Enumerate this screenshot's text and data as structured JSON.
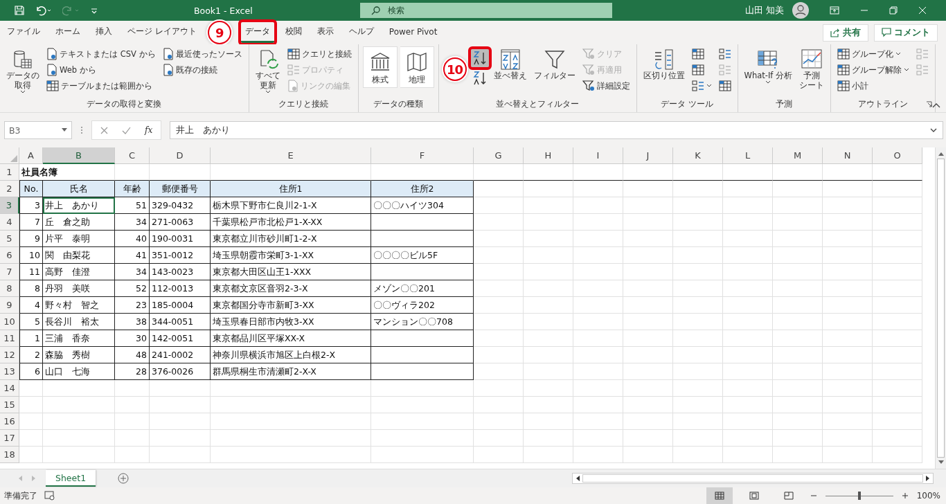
{
  "title_bar": {
    "document_title": "Book1  -  Excel",
    "search": {
      "placeholder": "検索"
    },
    "user": "山田 知美"
  },
  "ribbon_tabs": [
    {
      "label": "ファイル",
      "selected": false,
      "highlighted": false
    },
    {
      "label": "ホーム",
      "selected": false,
      "highlighted": false
    },
    {
      "label": "挿入",
      "selected": false,
      "highlighted": false
    },
    {
      "label": "ページ レイアウト",
      "selected": false,
      "highlighted": false
    },
    {
      "label": "データ",
      "selected": true,
      "highlighted": true
    },
    {
      "label": "校閲",
      "selected": false,
      "highlighted": false
    },
    {
      "label": "表示",
      "selected": false,
      "highlighted": false
    },
    {
      "label": "ヘルプ",
      "selected": false,
      "highlighted": false
    },
    {
      "label": "Power Pivot",
      "selected": false,
      "highlighted": false
    }
  ],
  "share_button": "共有",
  "comment_button": "コメント",
  "ribbon_groups": [
    {
      "title": "データの取得と変換",
      "columns": [
        [
          {
            "kind": "large",
            "lines": [
              "データの",
              "取得"
            ],
            "dropdown": true,
            "disabled": false,
            "highlighted": false
          }
        ],
        [
          {
            "kind": "small",
            "label": "テキストまたは CSV から",
            "dropdown": false,
            "disabled": false,
            "highlighted": false
          },
          {
            "kind": "small",
            "label": "Web から",
            "dropdown": false,
            "disabled": false,
            "highlighted": false
          },
          {
            "kind": "small",
            "label": "テーブルまたは範囲から",
            "dropdown": false,
            "disabled": false,
            "highlighted": false
          }
        ],
        [
          {
            "kind": "small",
            "label": "最近使ったソース",
            "dropdown": false,
            "disabled": false,
            "highlighted": false
          },
          {
            "kind": "small",
            "label": "既存の接続",
            "dropdown": false,
            "disabled": false,
            "highlighted": false
          }
        ]
      ]
    },
    {
      "title": "クエリと接続",
      "columns": [
        [
          {
            "kind": "large",
            "lines": [
              "すべて",
              "更新"
            ],
            "dropdown": true,
            "disabled": false,
            "highlighted": false
          }
        ],
        [
          {
            "kind": "small",
            "label": "クエリと接続",
            "dropdown": false,
            "disabled": false,
            "highlighted": false
          },
          {
            "kind": "small",
            "label": "プロパティ",
            "dropdown": false,
            "disabled": true,
            "highlighted": false
          },
          {
            "kind": "small",
            "label": "リンクの編集",
            "dropdown": false,
            "disabled": true,
            "highlighted": false
          }
        ]
      ]
    },
    {
      "title": "データの種類",
      "columns": [
        [
          {
            "kind": "gallery",
            "lines": [
              "株式"
            ],
            "dropdown": false,
            "disabled": false,
            "highlighted": false
          }
        ],
        [
          {
            "kind": "gallery",
            "lines": [
              "地理"
            ],
            "dropdown": false,
            "disabled": false,
            "highlighted": false
          }
        ]
      ]
    },
    {
      "title": "並べ替えとフィルター",
      "columns": [
        [
          {
            "kind": "icon",
            "dropdown": false,
            "disabled": false,
            "highlighted": true
          },
          {
            "kind": "icon",
            "dropdown": false,
            "disabled": false,
            "highlighted": false
          }
        ],
        [
          {
            "kind": "large",
            "lines": [
              "並べ替え"
            ],
            "dropdown": false,
            "disabled": false,
            "highlighted": false
          }
        ],
        [
          {
            "kind": "large",
            "lines": [
              "フィルター"
            ],
            "dropdown": false,
            "disabled": false,
            "highlighted": false
          }
        ],
        [
          {
            "kind": "small",
            "label": "クリア",
            "dropdown": false,
            "disabled": true,
            "highlighted": false
          },
          {
            "kind": "small",
            "label": "再適用",
            "dropdown": false,
            "disabled": true,
            "highlighted": false
          },
          {
            "kind": "small",
            "label": "詳細設定",
            "dropdown": false,
            "disabled": false,
            "highlighted": false
          }
        ]
      ]
    },
    {
      "title": "データ ツール",
      "columns": [
        [
          {
            "kind": "large",
            "lines": [
              "区切り位置"
            ],
            "dropdown": false,
            "disabled": false,
            "highlighted": false
          }
        ],
        [
          {
            "kind": "icon",
            "dropdown": false,
            "disabled": false,
            "highlighted": false
          },
          {
            "kind": "icon",
            "dropdown": false,
            "disabled": false,
            "highlighted": false
          },
          {
            "kind": "icon",
            "dropdown": true,
            "disabled": false,
            "highlighted": false
          }
        ],
        [
          {
            "kind": "icon",
            "dropdown": false,
            "disabled": false,
            "highlighted": false
          },
          {
            "kind": "icon",
            "dropdown": false,
            "disabled": true,
            "highlighted": false
          },
          {
            "kind": "icon",
            "dropdown": false,
            "disabled": false,
            "highlighted": false
          }
        ]
      ]
    },
    {
      "title": "予測",
      "columns": [
        [
          {
            "kind": "large",
            "lines": [
              "What-If 分析"
            ],
            "dropdown": true,
            "disabled": false,
            "highlighted": false
          }
        ],
        [
          {
            "kind": "large",
            "lines": [
              "予測",
              "シート"
            ],
            "dropdown": false,
            "disabled": false,
            "highlighted": false
          }
        ]
      ]
    },
    {
      "title": "アウトライン",
      "columns": [
        [
          {
            "kind": "small",
            "label": "グループ化",
            "dropdown": true,
            "disabled": false,
            "highlighted": false
          },
          {
            "kind": "small",
            "label": "グループ解除",
            "dropdown": true,
            "disabled": false,
            "highlighted": false
          },
          {
            "kind": "small",
            "label": "小計",
            "dropdown": false,
            "disabled": false,
            "highlighted": false
          }
        ],
        [
          {
            "kind": "icon",
            "dropdown": false,
            "disabled": true,
            "highlighted": false
          },
          {
            "kind": "icon",
            "dropdown": false,
            "disabled": true,
            "highlighted": false
          }
        ]
      ]
    }
  ],
  "callouts": [
    {
      "label": "9"
    },
    {
      "label": "10"
    }
  ],
  "formula_bar": {
    "name_box": "B3",
    "function_label": "fx",
    "value": "井上　あかり"
  },
  "sheet": {
    "columns": [
      {
        "letter": "A",
        "selected": false
      },
      {
        "letter": "B",
        "selected": true
      },
      {
        "letter": "C",
        "selected": false
      },
      {
        "letter": "D",
        "selected": false
      },
      {
        "letter": "E",
        "selected": false
      },
      {
        "letter": "F",
        "selected": false
      },
      {
        "letter": "G",
        "selected": false
      },
      {
        "letter": "H",
        "selected": false
      },
      {
        "letter": "I",
        "selected": false
      },
      {
        "letter": "J",
        "selected": false
      },
      {
        "letter": "K",
        "selected": false
      },
      {
        "letter": "L",
        "selected": false
      },
      {
        "letter": "M",
        "selected": false
      },
      {
        "letter": "N",
        "selected": false
      },
      {
        "letter": "O",
        "selected": false
      }
    ],
    "rows": [
      {
        "number": "1",
        "kind": "title",
        "selected": false,
        "cells": {
          "A": "社員名簿"
        }
      },
      {
        "number": "2",
        "kind": "header",
        "selected": false,
        "cells": {
          "A": "No.",
          "B": "氏名",
          "C": "年齢",
          "D": "郵便番号",
          "E": "住所1",
          "F": "住所2"
        }
      },
      {
        "number": "3",
        "kind": "data",
        "selected": true,
        "cells": {
          "A": "3",
          "B": "井上　あかり",
          "C": "51",
          "D": "329-0432",
          "E": "栃木県下野市仁良川2-1-X",
          "F": "〇〇〇ハイツ304"
        }
      },
      {
        "number": "4",
        "kind": "data",
        "selected": false,
        "cells": {
          "A": "7",
          "B": "丘　倉之助",
          "C": "34",
          "D": "271-0063",
          "E": "千葉県松戸市北松戸1-X-XX"
        }
      },
      {
        "number": "5",
        "kind": "data",
        "selected": false,
        "cells": {
          "A": "9",
          "B": "片平　泰明",
          "C": "40",
          "D": "190-0031",
          "E": "東京都立川市砂川町1-2-X"
        }
      },
      {
        "number": "6",
        "kind": "data",
        "selected": false,
        "cells": {
          "A": "10",
          "B": "関　由梨花",
          "C": "41",
          "D": "351-0012",
          "E": "埼玉県朝霞市栄町3-1-XX",
          "F": "〇〇〇〇ビル5F"
        }
      },
      {
        "number": "7",
        "kind": "data",
        "selected": false,
        "cells": {
          "A": "11",
          "B": "高野　佳澄",
          "C": "34",
          "D": "143-0023",
          "E": "東京都大田区山王1-XXX"
        }
      },
      {
        "number": "8",
        "kind": "data",
        "selected": false,
        "cells": {
          "A": "8",
          "B": "丹羽　美咲",
          "C": "52",
          "D": "112-0013",
          "E": "東京都文京区音羽2-3-X",
          "F": "メゾン〇〇201"
        }
      },
      {
        "number": "9",
        "kind": "data",
        "selected": false,
        "cells": {
          "A": "4",
          "B": "野々村　智之",
          "C": "23",
          "D": "185-0004",
          "E": "東京都国分寺市新町3-XX",
          "F": "〇〇ヴィラ202"
        }
      },
      {
        "number": "10",
        "kind": "data",
        "selected": false,
        "cells": {
          "A": "5",
          "B": "長谷川　裕太",
          "C": "38",
          "D": "344-0051",
          "E": "埼玉県春日部市内牧3-XX",
          "F": "マンション〇〇708"
        }
      },
      {
        "number": "11",
        "kind": "data",
        "selected": false,
        "cells": {
          "A": "1",
          "B": "三浦　香奈",
          "C": "30",
          "D": "142-0051",
          "E": "東京都品川区平塚XX-X"
        }
      },
      {
        "number": "12",
        "kind": "data",
        "selected": false,
        "cells": {
          "A": "2",
          "B": "森脇　秀樹",
          "C": "48",
          "D": "241-0002",
          "E": "神奈川県横浜市旭区上白根2-X"
        }
      },
      {
        "number": "13",
        "kind": "data",
        "selected": false,
        "cells": {
          "A": "6",
          "B": "山口　七海",
          "C": "28",
          "D": "376-0026",
          "E": "群馬県桐生市清瀬町2-X-X"
        }
      },
      {
        "number": "14",
        "kind": "empty",
        "selected": false,
        "cells": {}
      },
      {
        "number": "15",
        "kind": "empty",
        "selected": false,
        "cells": {}
      },
      {
        "number": "16",
        "kind": "empty",
        "selected": false,
        "cells": {}
      },
      {
        "number": "17",
        "kind": "empty",
        "selected": false,
        "cells": {}
      },
      {
        "number": "18",
        "kind": "empty",
        "selected": false,
        "cells": {}
      }
    ]
  },
  "sheet_tabs": [
    {
      "label": "Sheet1",
      "selected": true
    }
  ],
  "status_bar": {
    "status": "準備完了",
    "zoom": "100%",
    "zoom_slider": {
      "level": 0.5
    }
  }
}
